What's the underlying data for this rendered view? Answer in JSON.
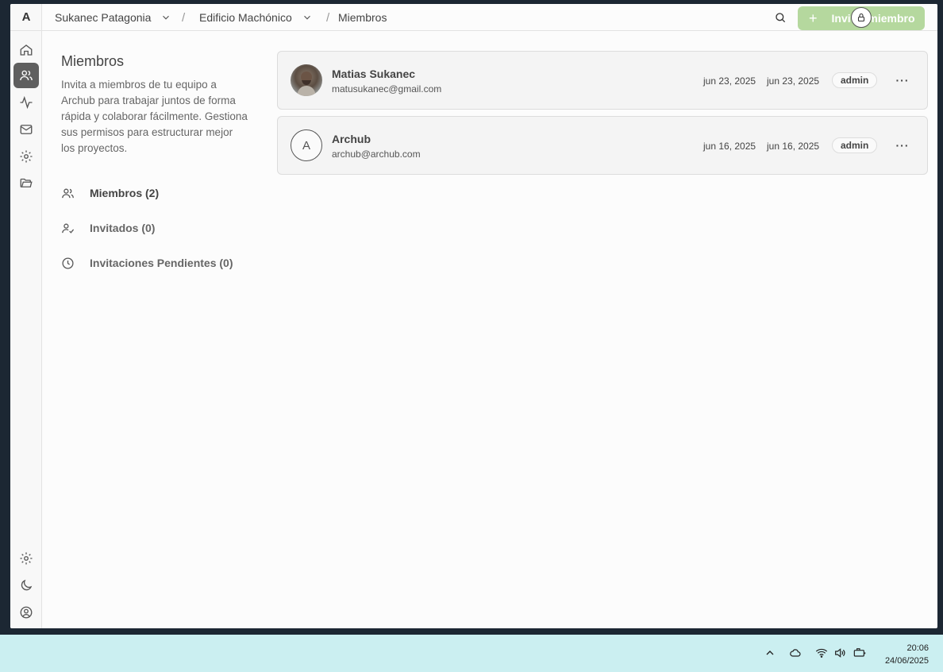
{
  "app": {
    "logo": "A"
  },
  "breadcrumb": {
    "org": "Sukanec Patagonia",
    "project": "Edificio Machónico",
    "page": "Miembros",
    "separator": "/"
  },
  "header": {
    "invite_label": "Invitar miembro",
    "invite_plus": "+"
  },
  "info": {
    "title": "Miembros",
    "description": "Invita a miembros de tu equipo a Archub para trabajar juntos de forma rápida y colaborar fácilmente. Gestiona sus permisos para estructurar mejor los proyectos."
  },
  "subnav": {
    "items": [
      {
        "label": "Miembros (2)",
        "icon": "users-icon"
      },
      {
        "label": "Invitados (0)",
        "icon": "user-check-icon"
      },
      {
        "label": "Invitaciones Pendientes (0)",
        "icon": "clock-icon"
      }
    ]
  },
  "members": [
    {
      "name": "Matias Sukanec",
      "email": "matusukanec@gmail.com",
      "date1": "jun 23, 2025",
      "date2": "jun 23, 2025",
      "role": "admin",
      "more": "···"
    },
    {
      "name": "Archub",
      "email": "archub@archub.com",
      "avatar_letter": "A",
      "date1": "jun 16, 2025",
      "date2": "jun 16, 2025",
      "role": "admin",
      "more": "···"
    }
  ],
  "taskbar": {
    "time": "20:06",
    "date": "24/06/2025"
  },
  "colors": {
    "invite_button": "#b5d89e",
    "rail_active": "#5f5f5f",
    "taskbar": "#cbeff1"
  }
}
